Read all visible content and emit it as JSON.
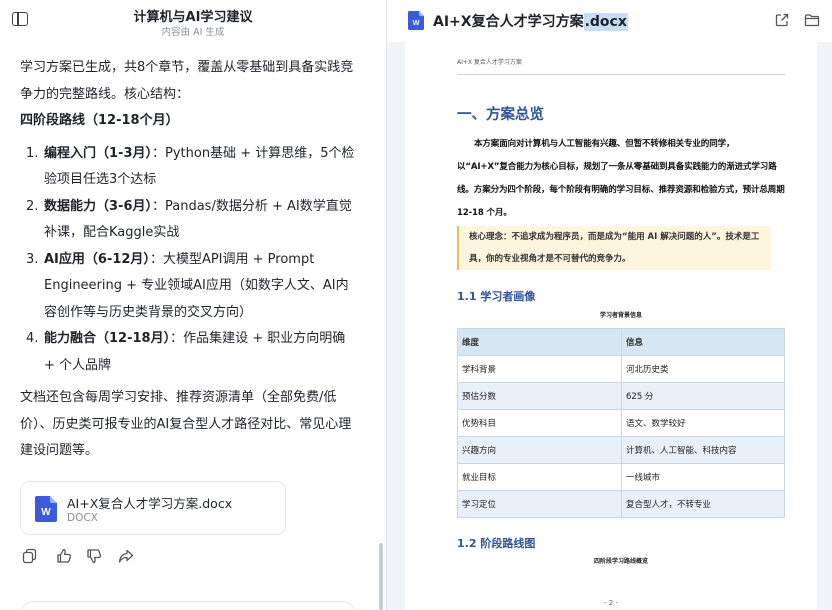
{
  "chat": {
    "title": "计算机与AI学习建议",
    "subtitle": "内容由 AI 生成",
    "intro": "学习方案已生成，共8个章节，覆盖从零基础到具备实践竞争力的完整路线。核心结构：",
    "stage_heading": "四阶段路线（12-18个月）",
    "stages": [
      {
        "num": "1.",
        "name": "编程入门（1-3月）",
        "desc": "：Python基础 + 计算思维，5个检验项目任选3个达标"
      },
      {
        "num": "2.",
        "name": "数据能力（3-6月）",
        "desc": "：Pandas/数据分析 + AI数学直觉补课，配合Kaggle实战"
      },
      {
        "num": "3.",
        "name": "AI应用（6-12月）",
        "desc": "：大模型API调用 + Prompt Engineering + 专业领域AI应用（如数字人文、AI内容创作等与历史类背景的交叉方向）"
      },
      {
        "num": "4.",
        "name": "能力融合（12-18月）",
        "desc": "：作品集建设 + 职业方向明确 + 个人品牌"
      }
    ],
    "closing": "文档还包含每周学习安排、推荐资源清单（全部免费/低价）、历史类可报专业的AI复合型人才路径对比、常见心理建设问题等。",
    "file": {
      "name": "AI+X复合人才学习方案.docx",
      "type": "DOCX",
      "icon_letter": "W"
    },
    "actions": [
      "copy-icon",
      "thumbs-up-icon",
      "thumbs-down-icon",
      "share-icon"
    ]
  },
  "preview": {
    "title_main": "AI+X复合人才学习方案",
    "title_ext": ".docx",
    "header_buttons": [
      "open-external-icon",
      "folder-icon"
    ],
    "page": {
      "running_head": "AI+X 复合人才学习方案",
      "h1": "一、方案总览",
      "paragraph": "本方案面向对计算机与人工智能有兴趣、但暂不转修相关专业的同学，以“AI+X”复合能力为核心目标，规划了一条从零基础到具备实践能力的渐进式学习路线。方案分为四个阶段，每个阶段有明确的学习目标、推荐资源和检验方式，预计总周期 12-18 个月。",
      "note": "核心理念：不追求成为程序员，而是成为“能用 AI 解决问题的人”。技术是工具，你的专业视角才是不可替代的竞争力。",
      "h2_profile": "1.1 学习者画像",
      "table_caption": "学习者背景信息",
      "table_header": [
        "维度",
        "信息"
      ],
      "table_rows": [
        [
          "学科背景",
          "河北历史类"
        ],
        [
          "预估分数",
          "625 分"
        ],
        [
          "优势科目",
          "语文、数学较好"
        ],
        [
          "兴趣方向",
          "计算机、人工智能、科技内容"
        ],
        [
          "就业目标",
          "一线城市"
        ],
        [
          "学习定位",
          "复合型人才，不转专业"
        ]
      ],
      "h2_route": "1.2 阶段路线图",
      "route_caption": "四阶段学习路线概览",
      "page_number": "- 2 -"
    }
  },
  "colors": {
    "heading_blue": "#2f5597",
    "word_icon": "#3b5bdb",
    "note_bg": "#fdf5dd",
    "table_header_bg": "#d6e6f2"
  }
}
